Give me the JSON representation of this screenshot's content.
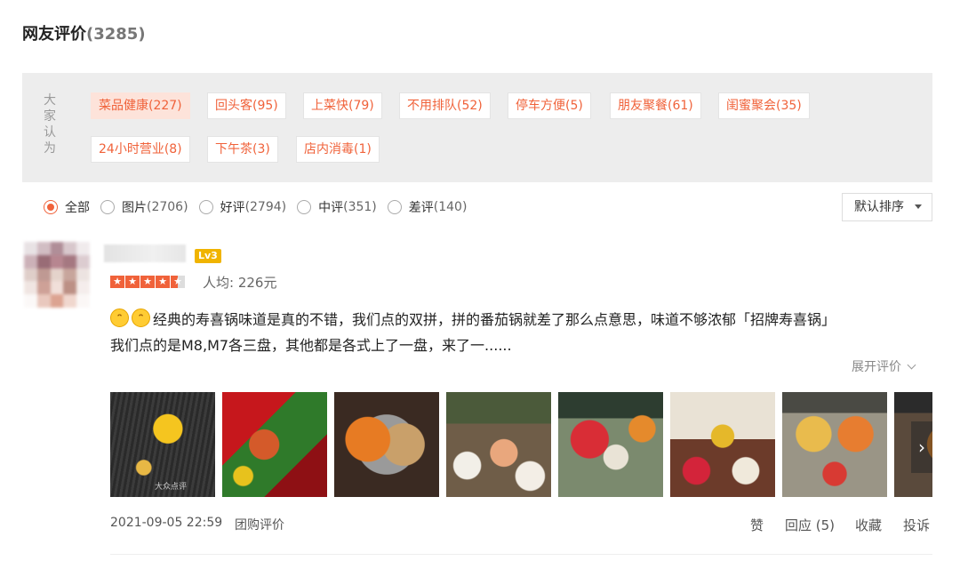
{
  "header": {
    "title": "网友评价",
    "count": "(3285)"
  },
  "tags": {
    "label": "大家认为",
    "items": [
      {
        "label": "菜品健康(227)"
      },
      {
        "label": "回头客(95)"
      },
      {
        "label": "上菜快(79)"
      },
      {
        "label": "不用排队(52)"
      },
      {
        "label": "停车方便(5)"
      },
      {
        "label": "朋友聚餐(61)"
      },
      {
        "label": "闺蜜聚会(35)"
      },
      {
        "label": "24小时营业(8)"
      },
      {
        "label": "下午茶(3)"
      },
      {
        "label": "店内消毒(1)"
      }
    ]
  },
  "filters": [
    {
      "label": "全部",
      "count": "",
      "selected": true
    },
    {
      "label": "图片",
      "count": "(2706)"
    },
    {
      "label": "好评",
      "count": "(2794)"
    },
    {
      "label": "中评",
      "count": "(351)"
    },
    {
      "label": "差评",
      "count": "(140)"
    }
  ],
  "sort": {
    "label": "默认排序"
  },
  "review": {
    "level": "Lv3",
    "rating": 4.5,
    "avg_price": "人均: 226元",
    "text_line1": "经典的寿喜锅味道是真的不错，我们点的双拼，拼的番茄锅就差了那么点意思，味道不够浓郁「招牌寿喜锅」",
    "text_line2": "我们点的是M8,M7各三盘，其他都是各式上了一盘，来了一......",
    "expand": "展开评价",
    "photo_count": 8,
    "date": "2021-09-05 22:59",
    "source": "团购评价",
    "actions": {
      "like": "赞",
      "reply": "回应 (5)",
      "fav": "收藏",
      "report": "投诉"
    }
  },
  "colors": {
    "accent": "#f0623a",
    "level_badge": "#f0b400",
    "tag_bg": "#ededed"
  }
}
